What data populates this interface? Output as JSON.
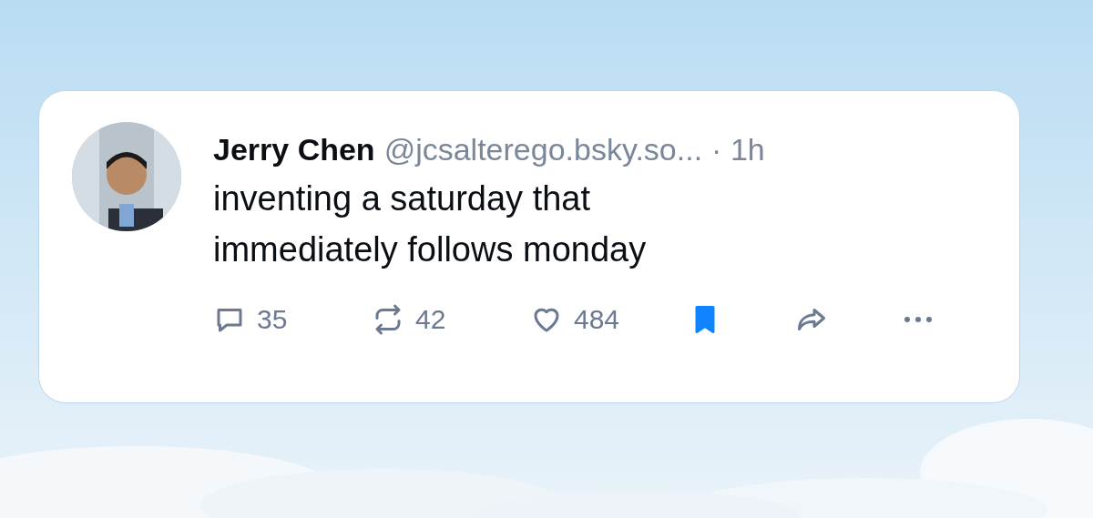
{
  "post": {
    "author": {
      "name": "Jerry Chen",
      "handle": "@jcsalterego.bsky.so..."
    },
    "time": "· 1h",
    "text_lines": [
      "inventing a saturday that",
      "immediately follows monday"
    ],
    "actions": [
      {
        "kind": "reply",
        "count": "35"
      },
      {
        "kind": "repost",
        "count": "42"
      },
      {
        "kind": "like",
        "count": "484"
      },
      {
        "kind": "bookmark",
        "selected": true
      },
      {
        "kind": "share"
      },
      {
        "kind": "more"
      }
    ]
  }
}
